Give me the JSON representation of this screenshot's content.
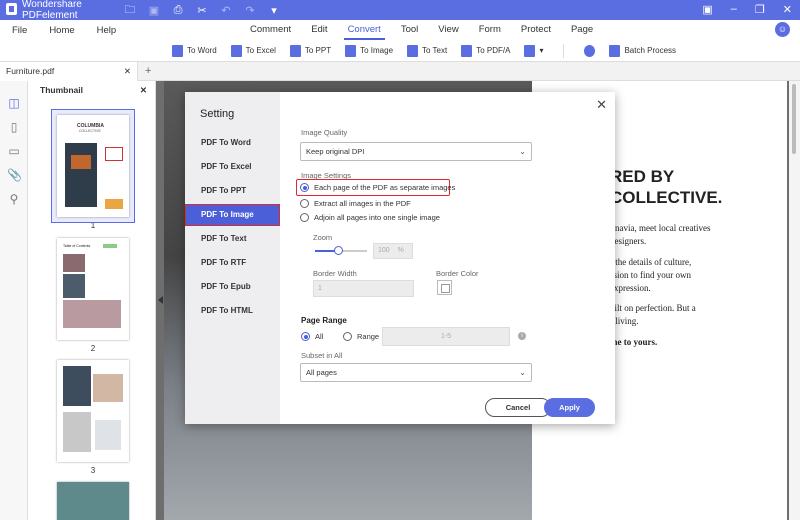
{
  "app": {
    "title": "Wondershare PDFelement"
  },
  "menubar": {
    "left": [
      "File",
      "Home",
      "Help"
    ],
    "center": [
      "Comment",
      "Edit",
      "Convert",
      "Tool",
      "View",
      "Form",
      "Protect",
      "Page"
    ],
    "active": "Convert"
  },
  "toolbar": {
    "items": [
      "To Word",
      "To Excel",
      "To PPT",
      "To Image",
      "To Text",
      "To PDF/A",
      "Batch Process"
    ]
  },
  "tab": {
    "filename": "Furniture.pdf"
  },
  "thumbnails": {
    "title": "Thumbnail",
    "pages": [
      "1",
      "2",
      "3"
    ],
    "page1_title": "COLUMBIA",
    "page1_subtitle": "COLLECTIVE",
    "page2_title": "Table of Contents"
  },
  "document": {
    "heading_line1": "RED BY",
    "heading_line2": "COLLECTIVE.",
    "para1_line1": "linavia, meet local creatives",
    "para1_line2": "designers.",
    "para2_line1": "r the details of culture,",
    "para2_line2": "ssion to find your own",
    "para2_line3": "expression.",
    "para3_line1": "uilt on perfection. But a",
    "para3_line2": "r living.",
    "para4": "me to yours."
  },
  "dialog": {
    "title": "Setting",
    "nav": [
      "PDF To Word",
      "PDF To Excel",
      "PDF To PPT",
      "PDF To Image",
      "PDF To Text",
      "PDF To RTF",
      "PDF To Epub",
      "PDF To HTML"
    ],
    "active_nav": "PDF To Image",
    "image_quality_label": "Image Quality",
    "image_quality_value": "Keep original DPI",
    "image_settings_label": "Image Settings",
    "options": [
      "Each page of the PDF as separate images",
      "Extract all images in the PDF",
      "Adjoin all pages into one single image"
    ],
    "selected_option": 0,
    "zoom_label": "Zoom",
    "zoom_value": "100",
    "zoom_unit": "%",
    "border_width_label": "Border Width",
    "border_width_value": "1",
    "border_color_label": "Border Color",
    "page_range_label": "Page Range",
    "all_label": "All",
    "range_label": "Range",
    "range_value": "1-5",
    "subset_label": "Subset in All",
    "subset_value": "All pages",
    "cancel": "Cancel",
    "apply": "Apply"
  }
}
